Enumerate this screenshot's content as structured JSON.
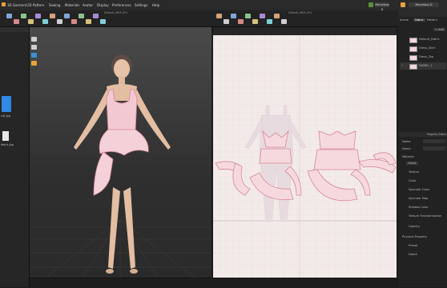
{
  "menu": {
    "items": [
      "3D Garment",
      "2D Pattern",
      "Sewing",
      "Materials",
      "Avatar",
      "Display",
      "Preferences",
      "Settings",
      "Help"
    ]
  },
  "user": {
    "label": "Marvelous D"
  },
  "viewport3d": {
    "title": "Default_MD5 (0*)"
  },
  "viewport2d": {
    "title": "Default_MD5 (0*)"
  },
  "left_panel": {
    "files": [
      {
        "label": "silk.jpg",
        "color": "#2e8ae6"
      },
      {
        "label": "fabric.jpg",
        "color": "#e6e6e6"
      }
    ]
  },
  "object_browser": {
    "tabs": [
      "Scene",
      "Fabric",
      "Pattern"
    ],
    "add_label": "+ Add",
    "fabrics": [
      {
        "name": "Default_Fabric",
        "checked": false
      },
      {
        "name": "Dress_Skirt",
        "checked": false
      },
      {
        "name": "Dress_Top",
        "checked": false
      },
      {
        "name": "FABRIC_1",
        "checked": true
      }
    ]
  },
  "property_editor": {
    "title": "Property Editor",
    "fields": [
      {
        "label": "Name",
        "value": "FABRIC_1"
      },
      {
        "label": "Name",
        "value": ""
      }
    ],
    "material_section": "Material",
    "front_tab": "Front",
    "material_rows": [
      "Texture",
      "Color",
      "Specular Color",
      "Specular Map",
      "Shadow Color",
      "Texture Transformation",
      "Opacity"
    ],
    "physical_section": "Physical Property",
    "physical_rows": [
      "Preset",
      "Detail"
    ]
  },
  "colors": {
    "accent": "#e9a33a",
    "dress": "#f2c9d2",
    "pattern_fill": "#f6d9de",
    "pattern_stroke": "#d6889a"
  }
}
